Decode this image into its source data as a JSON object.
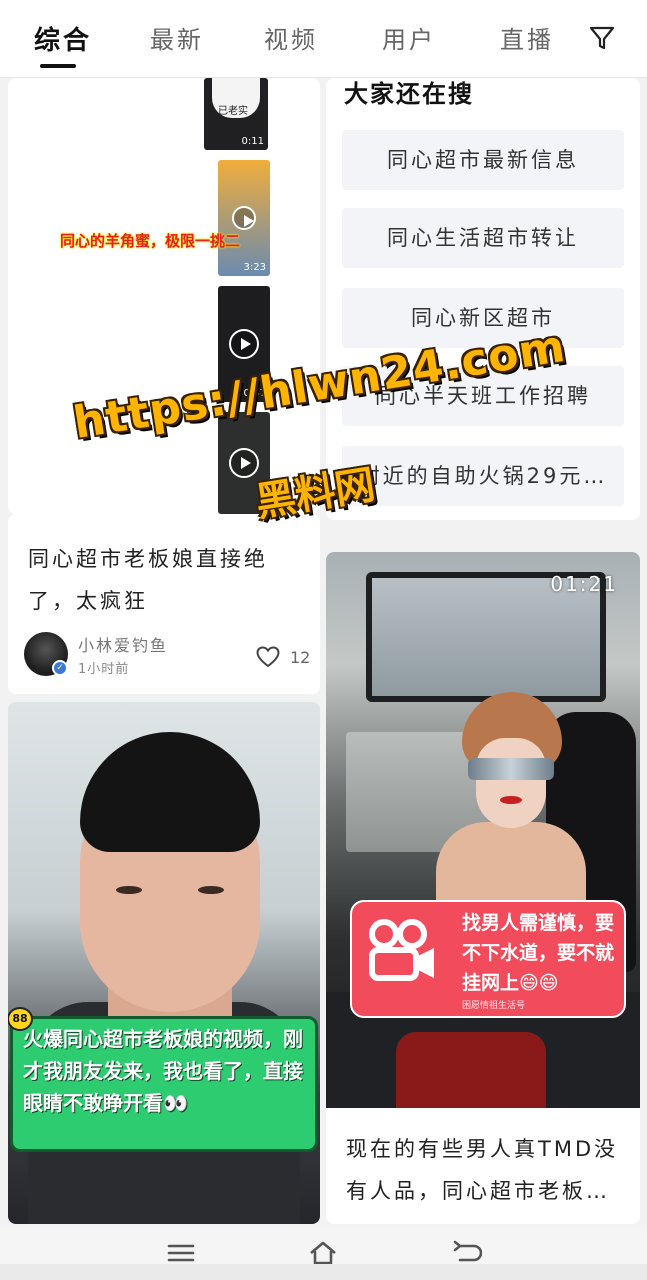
{
  "tabs": [
    {
      "label": "综合",
      "active": true
    },
    {
      "label": "最新",
      "active": false
    },
    {
      "label": "视频",
      "active": false
    },
    {
      "label": "用户",
      "active": false
    },
    {
      "label": "直播",
      "active": false
    }
  ],
  "filter_icon": "filter-icon",
  "thumbs_card": {
    "caption": "同心的羊角蜜，极限一挑二",
    "thumbs": [
      {
        "time": "0:11",
        "sticker": "已老实"
      },
      {
        "time": "3:23"
      },
      {
        "time": "0:47"
      },
      {
        "time": ""
      }
    ]
  },
  "search_card": {
    "heading": "大家还在搜",
    "items": [
      "同心超市最新信息",
      "同心生活超市转让",
      "同心新区超市",
      "同心半天班工作招聘",
      "附近的自助火锅29元…"
    ]
  },
  "post_card": {
    "title": "同心超市老板娘直接绝了，太疯狂",
    "author": "小林爱钓鱼",
    "time": "1小时前",
    "likes": "12"
  },
  "man_card": {
    "bubble_text": "火爆同心超市老板娘的视频，刚才我朋友发来，我也看了，直接眼睛不敢睁开看👀",
    "badge": "88"
  },
  "woman_card": {
    "duration": "01:21",
    "bubble_text": "找男人需谨慎，要不下水道，要不就挂网上😄😄",
    "bubble_sub": "困愿情祖生活号",
    "title": "现在的有些男人真TMD没有人品，同心超市老板…"
  },
  "watermark": {
    "url": "https://hlwn24.com",
    "name": "黑料网"
  },
  "navbar": {
    "icons": [
      "menu-icon",
      "home-icon",
      "back-icon"
    ]
  },
  "colors": {
    "accent_green": "#2ecc71",
    "accent_red": "#f24b5c",
    "watermark": "#ffb400"
  }
}
